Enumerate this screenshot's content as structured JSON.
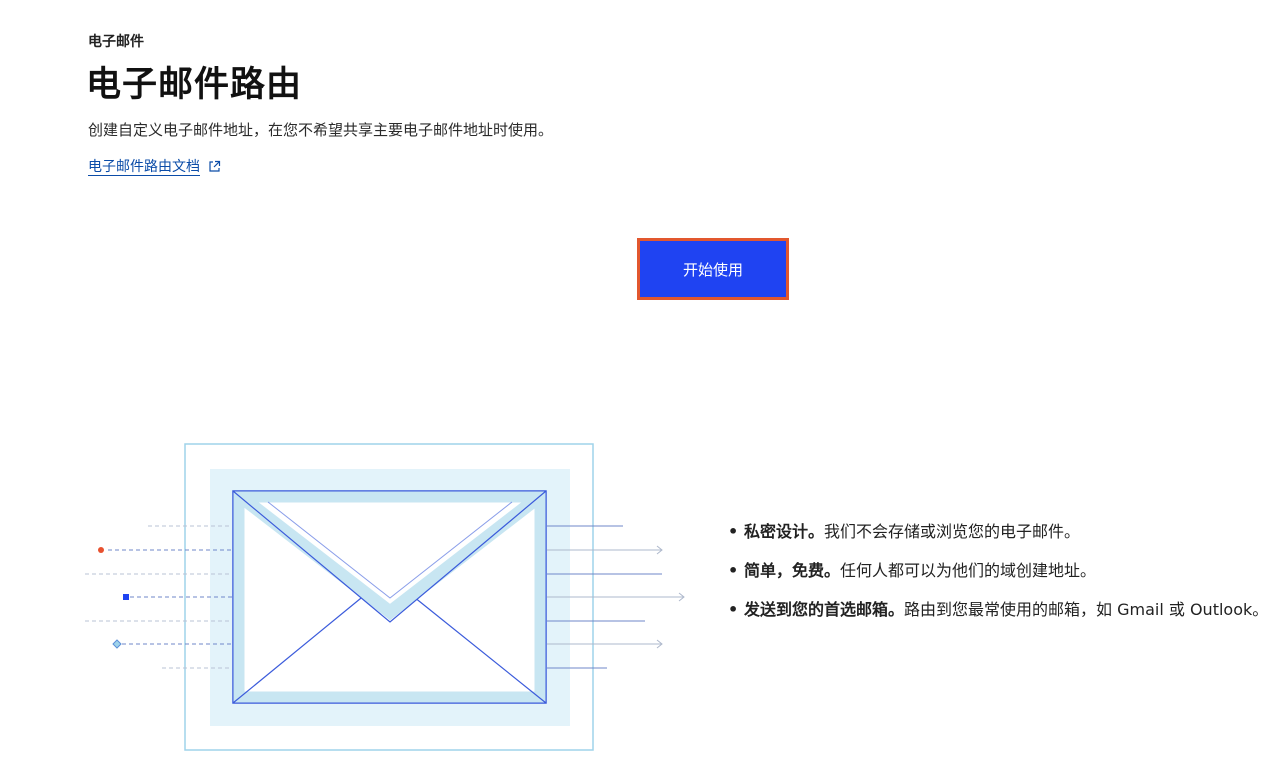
{
  "header": {
    "breadcrumb": "电子邮件",
    "title": "电子邮件路由",
    "subtitle": "创建自定义电子邮件地址，在您不希望共享主要电子邮件地址时使用。",
    "doc_link": "电子邮件路由文档"
  },
  "main": {
    "start_button": "开始使用"
  },
  "features": [
    {
      "bold": "私密设计。",
      "text": "我们不会存储或浏览您的电子邮件。"
    },
    {
      "bold": "简单，免费。",
      "text": "任何人都可以为他们的域创建地址。"
    },
    {
      "bold": "发送到您的首选邮箱。",
      "text": "路由到您最常使用的邮箱，如 Gmail 或 Outlook。"
    }
  ],
  "colors": {
    "primary_button": "#1f43f2",
    "button_highlight_border": "#e2572e",
    "link": "#0b4ca8",
    "envelope_stroke": "#3b5bdb",
    "envelope_fill": "#c8e6f2"
  },
  "icons": {
    "doc_link_icon": "external-link-icon",
    "illustration": "envelope-illustration"
  }
}
